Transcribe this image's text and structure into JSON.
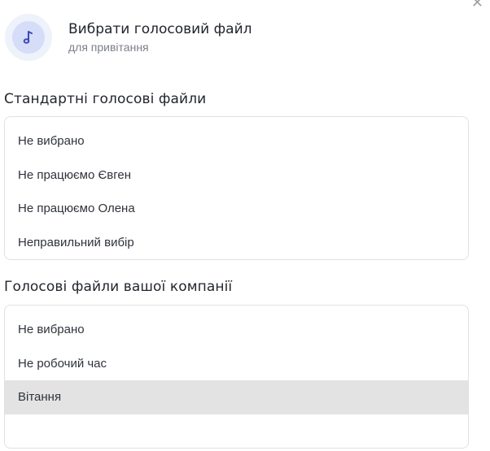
{
  "header": {
    "title": "Вибрати голосовий файл",
    "subtitle": "для привітання",
    "icon": "music-note-icon",
    "close_icon": "close-icon",
    "accent_color": "#3d47b8"
  },
  "standard_section": {
    "title": "Стандартні голосові файли",
    "options": [
      {
        "label": "Не вибрано"
      },
      {
        "label": "Не працюємо Євген"
      },
      {
        "label": "Не працюємо Олена"
      },
      {
        "label": "Неправильний вибір"
      }
    ]
  },
  "company_section": {
    "title": "Голосові файли вашої компанії",
    "selected_index": 2,
    "selected_color": "#e3e3e3",
    "options": [
      {
        "label": "Не вибрано"
      },
      {
        "label": "Не робочий час"
      },
      {
        "label": "Вітання"
      }
    ]
  }
}
